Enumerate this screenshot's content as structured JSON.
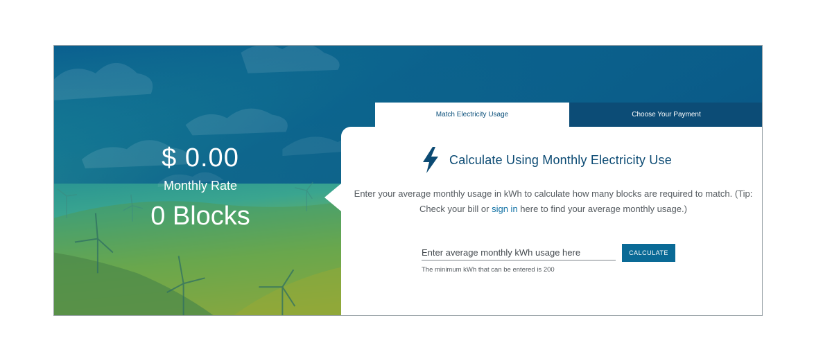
{
  "summary": {
    "rate_amount": "$ 0.00",
    "rate_label": "Monthly Rate",
    "blocks": "0 Blocks"
  },
  "tabs": [
    {
      "label": "Match Electricity Usage",
      "active": true
    },
    {
      "label": "Choose Your Payment",
      "active": false
    }
  ],
  "calculator": {
    "icon": "lightning-bolt-icon",
    "heading": "Calculate Using Monthly Electricity Use",
    "description_before": "Enter your average monthly usage in kWh to calculate how many blocks are required to match. (Tip: Check your bill or ",
    "description_link": "sign in",
    "description_after": " here to find your average monthly usage.)",
    "input_placeholder": "Enter average monthly kWh usage here",
    "input_value": "",
    "button_label": "CALCULATE",
    "hint": "The minimum kWh that can be entered is 200"
  },
  "colors": {
    "primary_blue": "#0b4a73",
    "button_blue": "#0a6a96",
    "link_blue": "#0d6fa3",
    "tab_inactive_bg": "#0c4c76"
  }
}
